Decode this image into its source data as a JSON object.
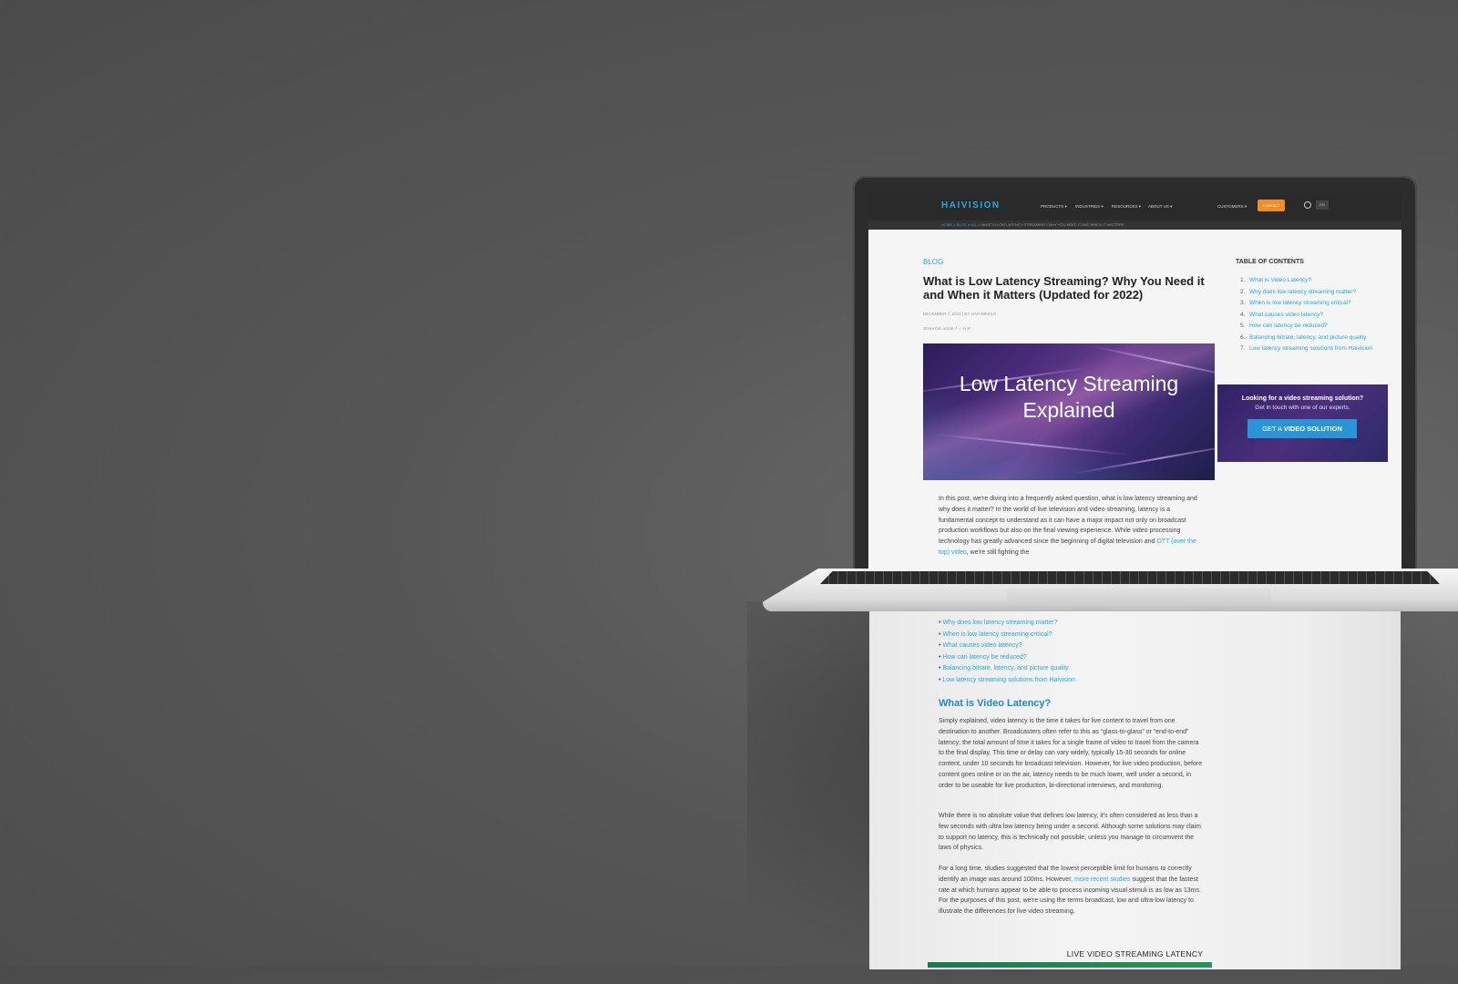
{
  "site": {
    "logo": "HAIVISION",
    "nav": [
      "PRODUCTS ▾",
      "INDUSTRIES ▾",
      "RESOURCES ▾",
      "ABOUT US ▾"
    ],
    "customers": "CUSTOMERS ▾",
    "contact": "CONTACT",
    "lang": "EN",
    "breadcrumb": {
      "home": "HOME",
      "blog": "BLOG",
      "all": "ALL",
      "current": "WHAT IS LOW LATENCY STREAMING? WHY YOU NEED IT AND WHEN IT MATTERS"
    }
  },
  "article": {
    "tag": "BLOG",
    "title": "What is Low Latency Streaming? Why You Need it and When it Matters (Updated for 2022)",
    "meta": "DECEMBER 7, 2021 | BY LINA NIKOLS",
    "share": "Share this article:  f  ✓  in  ✉",
    "hero_text": "Low Latency Streaming Explained",
    "intro_before_link": "In this post, we're diving into a frequently asked question, what is low latency streaming and why does it matter? In the world of live television and video streaming, latency is a fundamental concept to understand as it can have a major impact not only on broadcast production workflows but also on the final viewing experience. While video processing technology has greatly advanced since the beginning of digital television and ",
    "intro_link": "OTT (over the top) video",
    "intro_after_link": ", we're still fighting the"
  },
  "toc": {
    "heading": "TABLE OF CONTENTS",
    "items": [
      {
        "num": "1.",
        "label": "What is Video Latency?"
      },
      {
        "num": "2.",
        "label": "Why does low latency streaming matter?"
      },
      {
        "num": "3.",
        "label": "When is low latency streaming critical?"
      },
      {
        "num": "4.",
        "label": "What causes video latency?"
      },
      {
        "num": "5.",
        "label": "How can latency be reduced?"
      },
      {
        "num": "6.",
        "label": "Balancing bitrate, latency, and picture quality"
      },
      {
        "num": "7.",
        "label": "Low latency streaming solutions from Haivision"
      }
    ]
  },
  "cta": {
    "heading": "Looking for a video streaming solution?",
    "sub": "Get in touch with one of our experts.",
    "button_pre": "GET A ",
    "button_bold": "VIDEO SOLUTION"
  },
  "lower": {
    "links": [
      "Why does low latency streaming matter?",
      "When is low latency streaming critical?",
      "What causes video latency?",
      "How can latency be reduced?",
      "Balancing bitrate, latency, and picture quality",
      "Low latency streaming solutions from Haivision"
    ],
    "section_heading": "What is Video Latency?",
    "p1": "Simply explained, video latency is the time it takes for live content to travel from one destination to another. Broadcasters often refer to this as “glass-to-glass” or “end-to-end” latency; the total amount of time it takes for a single frame of video to travel from the camera to the final display. This time or delay can vary widely, typically 15-30 seconds for online content, under 10 seconds for broadcast television. However, for live video production, before content goes online or on the air, latency needs to be much lower, well under a second, in order to be useable for live production, bi-directional interviews, and monitoring.",
    "p2": "While there is no absolute value that defines low latency, it's often considered as less than a few seconds with ultra low latency being under a second. Although some solutions may claim to support no latency, this is technically not possible, unless you manage to circumvent the laws of physics.",
    "p3_before": "For a long time, studies suggested that the lowest perceptible limit for humans to correctly identify an image was around 100ms. However, ",
    "p3_link": "more recent studies",
    "p3_after": " suggest that the fastest rate at which humans appear to be able to process incoming visual stimuli is as low as 13ms. For the purposes of this post, we're using the terms broadcast, low and ultra-low latency to illustrate the differences for live video streaming.",
    "chart_title": "LIVE VIDEO STREAMING LATENCY"
  }
}
